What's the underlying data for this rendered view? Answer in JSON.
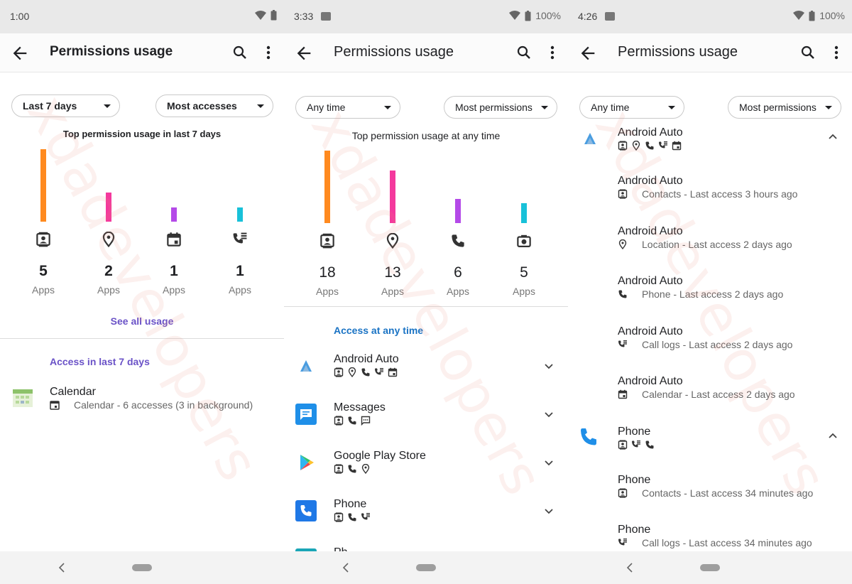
{
  "panels": [
    {
      "status": {
        "time": "1:00",
        "battery": ""
      },
      "appbar": {
        "title": "Permissions usage"
      },
      "filters": {
        "time": "Last 7 days",
        "sort": "Most accesses"
      },
      "chart_title": "Top permission usage in last 7 days",
      "chart_data": {
        "type": "bar",
        "categories": [
          "contacts",
          "location",
          "calendar",
          "call-logs"
        ],
        "series": [
          {
            "values": [
              5,
              2,
              1,
              1
            ]
          }
        ],
        "count_labels": [
          "5",
          "2",
          "1",
          "1"
        ],
        "apps_label": "Apps",
        "colors": [
          "#ff8a1f",
          "#f4399d",
          "#b44ae8",
          "#18c1d9"
        ]
      },
      "see_all": "See all usage",
      "section": "Access in last 7 days",
      "list": [
        {
          "title": "Calendar",
          "icon": "calendar-app-icon",
          "sub": "Calendar - 6 accesses (3 in background)"
        }
      ]
    },
    {
      "status": {
        "time": "3:33",
        "battery": "100%"
      },
      "appbar": {
        "title": "Permissions usage"
      },
      "filters": {
        "time": "Any time",
        "sort": "Most permissions"
      },
      "chart_title": "Top permission usage at any time",
      "chart_data": {
        "type": "bar",
        "categories": [
          "contacts",
          "location",
          "phone",
          "camera"
        ],
        "series": [
          {
            "values": [
              18,
              13,
              6,
              5
            ]
          }
        ],
        "count_labels": [
          "18",
          "13",
          "6",
          "5"
        ],
        "apps_label": "Apps",
        "colors": [
          "#ff8a1f",
          "#f4399d",
          "#b44ae8",
          "#18c1d9"
        ]
      },
      "section": "Access at any time",
      "list": [
        {
          "title": "Android Auto",
          "icon": "android-auto-icon",
          "perms": [
            "contacts",
            "location",
            "phone",
            "call-logs",
            "calendar"
          ]
        },
        {
          "title": "Messages",
          "icon": "messages-icon",
          "perms": [
            "contacts",
            "phone",
            "sms"
          ]
        },
        {
          "title": "Google Play Store",
          "icon": "play-store-icon",
          "perms": [
            "contacts",
            "phone",
            "location"
          ]
        },
        {
          "title": "Phone",
          "icon": "phone-app-icon",
          "perms": [
            "contacts",
            "phone",
            "call-logs"
          ]
        },
        {
          "title": "Ph",
          "icon": "partial-app-icon",
          "perms": []
        }
      ]
    },
    {
      "status": {
        "time": "4:26",
        "battery": "100%"
      },
      "appbar": {
        "title": "Permissions usage"
      },
      "filters": {
        "time": "Any time",
        "sort": "Most permissions"
      },
      "groups": [
        {
          "title": "Android Auto",
          "icon": "android-auto-icon",
          "perms": [
            "contacts",
            "location",
            "phone",
            "call-logs",
            "calendar"
          ],
          "items": [
            {
              "title": "Android Auto",
              "perm": "contacts",
              "sub": "Contacts - Last access 3 hours ago"
            },
            {
              "title": "Android Auto",
              "perm": "location",
              "sub": "Location - Last access 2 days ago"
            },
            {
              "title": "Android Auto",
              "perm": "phone",
              "sub": "Phone - Last access 2 days ago"
            },
            {
              "title": "Android Auto",
              "perm": "call-logs",
              "sub": "Call logs - Last access 2 days ago"
            },
            {
              "title": "Android Auto",
              "perm": "calendar",
              "sub": "Calendar - Last access 2 days ago"
            }
          ]
        },
        {
          "title": "Phone",
          "icon": "phone-app-icon",
          "perms": [
            "contacts",
            "call-logs",
            "phone"
          ],
          "items": [
            {
              "title": "Phone",
              "perm": "contacts",
              "sub": "Contacts - Last access 34 minutes ago"
            },
            {
              "title": "Phone",
              "perm": "call-logs",
              "sub": "Call logs - Last access 34 minutes ago"
            }
          ]
        }
      ]
    }
  ],
  "watermark": "xdadevelopers"
}
